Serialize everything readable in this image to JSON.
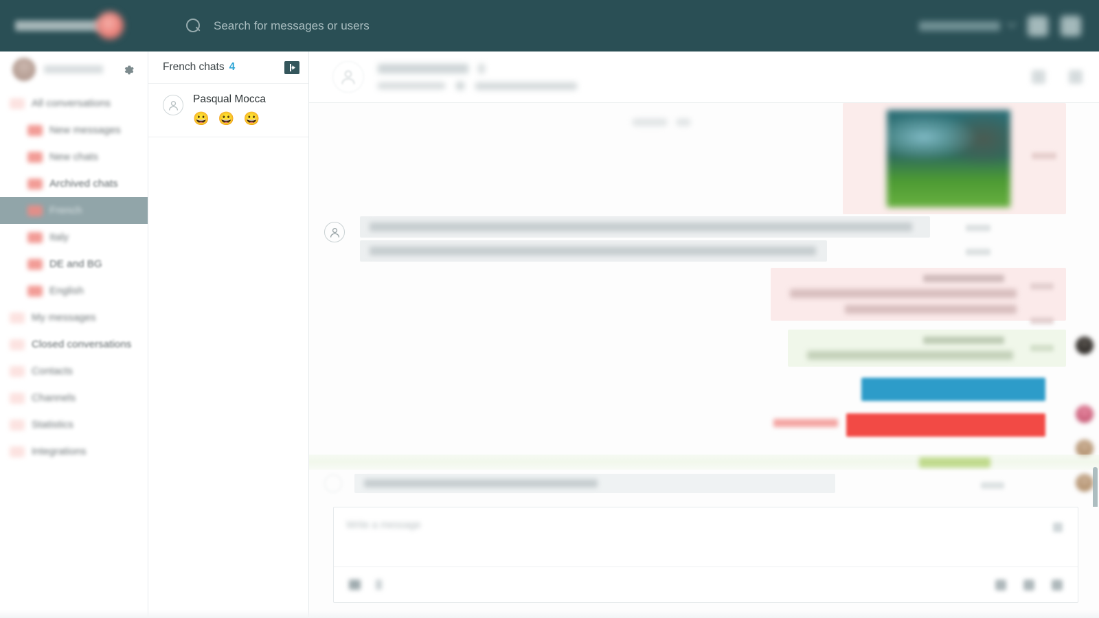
{
  "topbar": {
    "brand_name": "",
    "search": {
      "placeholder": "Search for messages or users",
      "value": "",
      "icon": "search-icon"
    },
    "account": {
      "label": "",
      "chevron_icon": "chevron-down-icon"
    },
    "icons": [
      "notifications-icon",
      "menu-icon"
    ]
  },
  "sidebar": {
    "user": {
      "name": "",
      "avatar": "user-avatar"
    },
    "settings_icon": "gear-icon",
    "items": [
      {
        "label": "All conversations",
        "level": 1,
        "count": "",
        "active": false
      },
      {
        "label": "New messages",
        "level": 2,
        "count": "",
        "active": false
      },
      {
        "label": "New chats",
        "level": 2,
        "count": "",
        "active": false
      },
      {
        "label": "Archived chats",
        "level": 2,
        "count": "",
        "active": false
      },
      {
        "label": "French",
        "level": 2,
        "count": "",
        "active": true
      },
      {
        "label": "Italy",
        "level": 2,
        "count": "",
        "active": false
      },
      {
        "label": "DE and BG",
        "level": 2,
        "count": "",
        "active": false
      },
      {
        "label": "English",
        "level": 2,
        "count": "",
        "active": false
      },
      {
        "label": "My messages",
        "level": 1,
        "count": "",
        "active": false
      },
      {
        "label": "Closed conversations",
        "level": 1,
        "count": "",
        "active": false
      },
      {
        "label": "Contacts",
        "level": 1,
        "count": "",
        "active": false
      },
      {
        "label": "Channels",
        "level": 1,
        "count": "",
        "active": false
      },
      {
        "label": "Statistics",
        "level": 1,
        "count": "",
        "active": false
      },
      {
        "label": "Integrations",
        "level": 1,
        "count": "",
        "active": false
      }
    ]
  },
  "chatlist": {
    "title": "French chats",
    "count": "4",
    "action_icon": "assign-arrow-icon",
    "items": [
      {
        "name": "Pasqual Mocca",
        "preview": "😀 😀 😀",
        "avatar_icon": "user-avatar-icon"
      }
    ]
  },
  "conversation": {
    "header": {
      "name": "",
      "flag": "",
      "phone": "",
      "email": "",
      "actions": [
        "tag-icon",
        "more-icon"
      ]
    },
    "messages": [
      {
        "type": "image",
        "direction": "out",
        "tint": "pink",
        "text": "",
        "time": ""
      },
      {
        "type": "text",
        "direction": "in",
        "text": "Please ...",
        "second_line": "state ...",
        "time": ""
      },
      {
        "type": "text",
        "direction": "out",
        "tint": "pink",
        "sender": "",
        "text": "",
        "time": ""
      },
      {
        "type": "text",
        "direction": "out",
        "tint": "green",
        "sender": "",
        "text": "",
        "time": ""
      },
      {
        "type": "bar",
        "direction": "out",
        "color": "#2d9cc9",
        "text": ""
      },
      {
        "type": "bar",
        "direction": "out",
        "color": "#f24a45",
        "text": "",
        "label": ""
      },
      {
        "type": "divider",
        "label": "",
        "color": "#c0da8d"
      },
      {
        "type": "note",
        "direction": "in",
        "text": "",
        "time": ""
      }
    ]
  },
  "composer": {
    "placeholder": "Write a message",
    "value": "",
    "left_icons": [
      "attachment-icon",
      "template-icon"
    ],
    "right_icons": [
      "emoji-icon",
      "image-icon",
      "send-icon"
    ],
    "clear_icon": "close-icon"
  },
  "colors": {
    "topbar": "#2a4f55",
    "accent_blue": "#2fa6d6",
    "sidebar_active": "#91a5a9",
    "badge_red": "#f08b84",
    "bubble_pink": "#fbeaea",
    "bubble_green": "#f0f7ea",
    "bar_blue": "#2d9cc9",
    "bar_red": "#f24a45",
    "divider_green": "#c0da8d"
  }
}
